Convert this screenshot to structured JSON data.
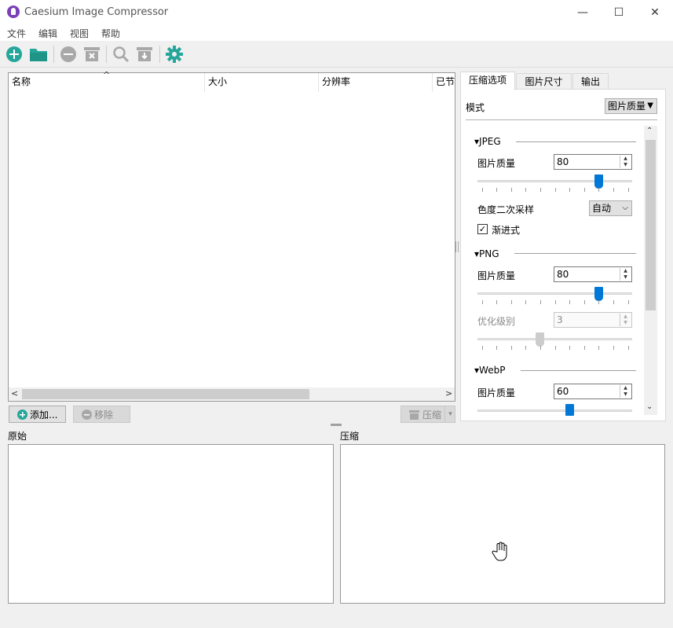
{
  "window": {
    "title": "Caesium Image Compressor",
    "controls": {
      "minimize": "—",
      "maximize": "☐",
      "close": "✕"
    }
  },
  "menu": [
    "文件",
    "编辑",
    "视图",
    "帮助"
  ],
  "toolbar": {
    "icons": [
      "add-icon",
      "open-folder-icon",
      "remove-icon",
      "clear-list-icon",
      "preview-search-icon",
      "export-icon",
      "settings-icon"
    ],
    "accent": "#26a69a"
  },
  "file_list": {
    "sort_indicator": "^",
    "columns": [
      "名称",
      "大小",
      "分辨率",
      "已节"
    ],
    "rows": [],
    "scroll_left": "<",
    "scroll_right": ">"
  },
  "list_buttons": {
    "add_label": "添加...",
    "remove_label": "移除",
    "compress_label": "压缩"
  },
  "options": {
    "tabs": [
      "压缩选项",
      "图片尺寸",
      "输出"
    ],
    "active_tab": "压缩选项",
    "mode_label": "模式",
    "mode_value": "图片质量",
    "jpeg": {
      "title": "JPEG",
      "quality_label": "图片质量",
      "quality": "80",
      "quality_level": 80,
      "chroma_label": "色度二次采样",
      "chroma_value": "自动",
      "progressive_label": "渐进式",
      "progressive_checked": true
    },
    "png": {
      "title": "PNG",
      "quality_label": "图片质量",
      "quality": "80",
      "quality_level": 80,
      "opt_label": "优化级别",
      "opt_value": "3",
      "opt_level_fraction": 0.4
    },
    "webp": {
      "title": "WebP",
      "quality_label": "图片质量",
      "quality": "60",
      "quality_level": 60
    }
  },
  "preview": {
    "original_label": "原始",
    "compressed_label": "压缩"
  }
}
